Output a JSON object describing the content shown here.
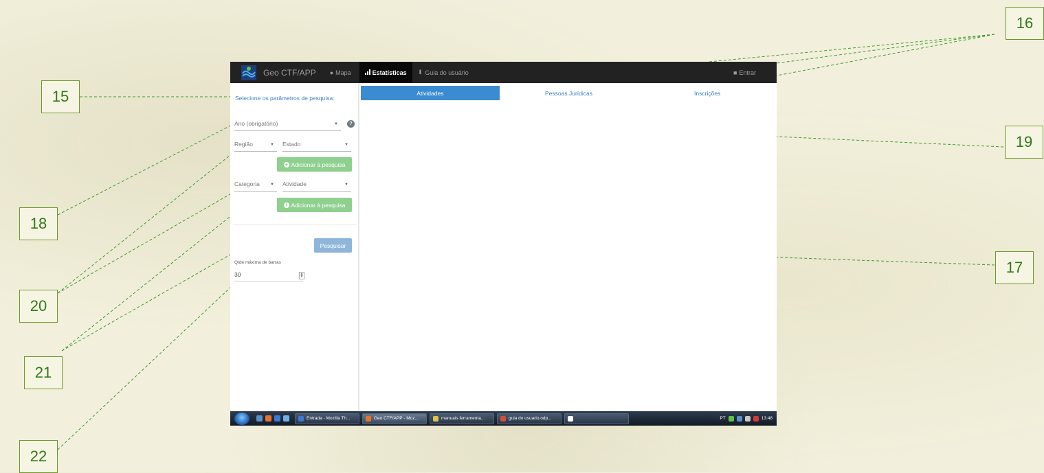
{
  "callouts": {
    "c15": "15",
    "c16": "16",
    "c17": "17",
    "c18": "18",
    "c19": "19",
    "c20": "20",
    "c21": "21",
    "c22": "22"
  },
  "navbar": {
    "brand": "Geo CTF/APP",
    "items": [
      {
        "label": "Mapa",
        "icon": "globe-icon"
      },
      {
        "label": "Estatísticas",
        "icon": "bar-chart-icon",
        "active": true
      },
      {
        "label": "Guia do usuário",
        "icon": "download-icon"
      }
    ],
    "login": "Entrar",
    "login_icon": "user-icon"
  },
  "sidebar": {
    "title": "Selecione os parâmetros de pesquisa:",
    "ano_placeholder": "Ano (obrigatório)",
    "regiao_placeholder": "Região",
    "estado_placeholder": "Estado",
    "add_button_1": "Adicionar à pesquisa",
    "categoria_placeholder": "Categoria",
    "atividade_placeholder": "Atividade",
    "add_button_2": "Adicionar à pesquisa",
    "search_button": "Pesquisar",
    "qtde_label": "Qtde máxima de barras",
    "qtde_value": "30"
  },
  "tabs": [
    {
      "label": "Atividades",
      "active": true
    },
    {
      "label": "Pessoas Jurídicas"
    },
    {
      "label": "Inscrições"
    }
  ],
  "taskbar": {
    "tasks": [
      {
        "label": "Entrada - Mozilla Th...",
        "color": "#3b7bd4"
      },
      {
        "label": "Geo CTF/APP - Moz...",
        "color": "#e8732a"
      },
      {
        "label": "manuais ferramenta...",
        "color": "#e0c34a"
      },
      {
        "label": "guia do usuario.odp...",
        "color": "#d0503a"
      },
      {
        "label": "",
        "color": "#ffffff"
      }
    ],
    "lang": "PT",
    "clock": "13:48"
  },
  "colors": {
    "accent": "#3a8bd1",
    "success": "#8fd08f",
    "callout_line": "#3d9a2a"
  }
}
